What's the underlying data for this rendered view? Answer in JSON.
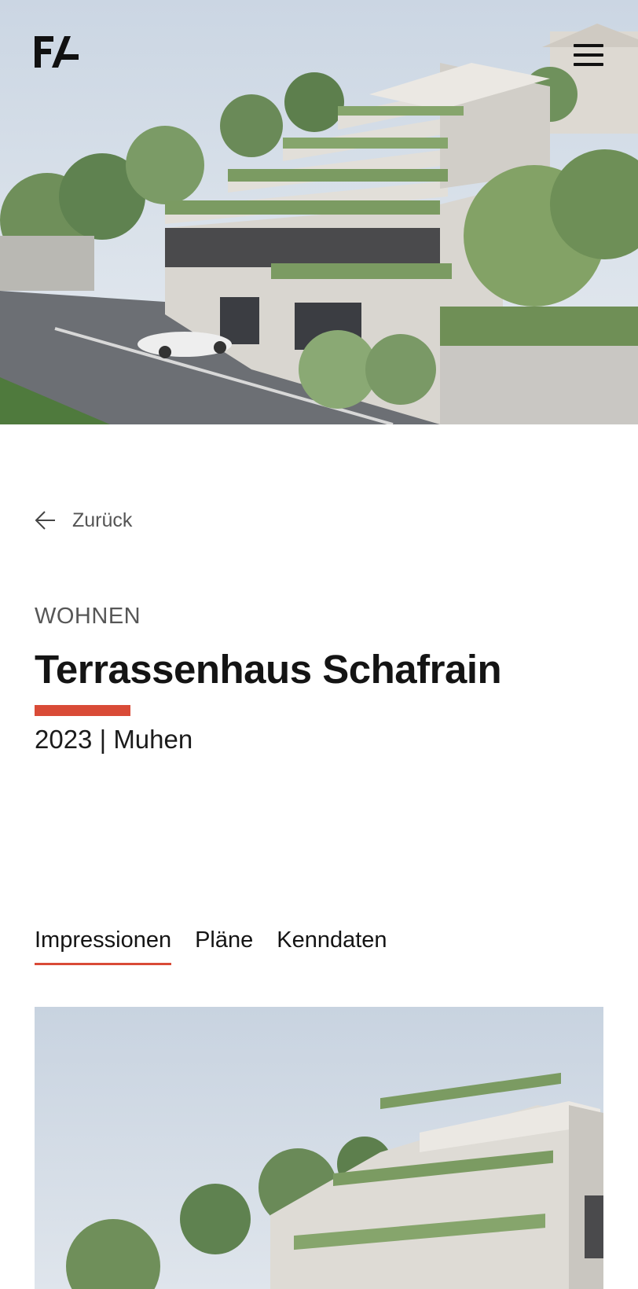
{
  "brand": {
    "logo_text": "FA",
    "accent_color": "#d94b37"
  },
  "header": {
    "menu_icon": "hamburger-menu-icon"
  },
  "hero": {
    "image": "Rendering of terraced apartment building with green plants on slope"
  },
  "nav": {
    "back_label": "Zurück",
    "back_icon": "arrow-left-icon"
  },
  "project": {
    "category": "WOHNEN",
    "title": "Terrassenhaus Schafrain",
    "meta": "2023 | Muhen"
  },
  "tabs": [
    {
      "label": "Impressionen",
      "active": true
    },
    {
      "label": "Pläne",
      "active": false
    },
    {
      "label": "Kenndaten",
      "active": false
    }
  ],
  "gallery": {
    "image": "Rendering of terraced building with trees"
  }
}
